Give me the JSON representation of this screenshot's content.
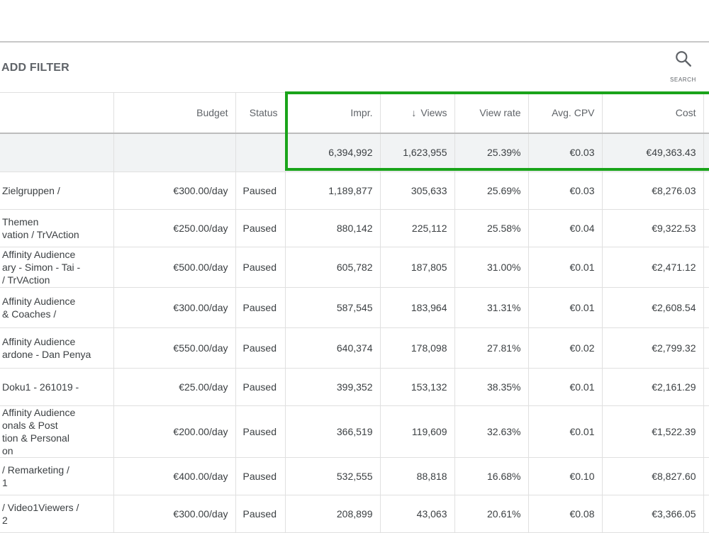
{
  "toolbar": {
    "add_filter_label": "ADD FILTER",
    "search_label": "SEARCH",
    "search_icon": "search-icon"
  },
  "table": {
    "headers": {
      "budget": "Budget",
      "status": "Status",
      "impr": "Impr.",
      "views": "Views",
      "view_rate": "View rate",
      "avg_cpv": "Avg. CPV",
      "cost": "Cost"
    },
    "totals": {
      "impr": "6,394,992",
      "views": "1,623,955",
      "view_rate": "25.39%",
      "avg_cpv": "€0.03",
      "cost": "€49,363.43"
    },
    "rows": [
      {
        "campaign": [
          "Zielgruppen /"
        ],
        "budget": "€300.00/day",
        "status": "Paused",
        "impr": "1,189,877",
        "views": "305,633",
        "view_rate": "25.69%",
        "avg_cpv": "€0.03",
        "cost": "€8,276.03"
      },
      {
        "campaign": [
          "Themen",
          "vation / TrVAction"
        ],
        "budget": "€250.00/day",
        "status": "Paused",
        "impr": "880,142",
        "views": "225,112",
        "view_rate": "25.58%",
        "avg_cpv": "€0.04",
        "cost": "€9,322.53"
      },
      {
        "campaign": [
          "Affinity Audience",
          "ary - Simon - Tai -",
          "/ TrVAction"
        ],
        "budget": "€500.00/day",
        "status": "Paused",
        "impr": "605,782",
        "views": "187,805",
        "view_rate": "31.00%",
        "avg_cpv": "€0.01",
        "cost": "€2,471.12"
      },
      {
        "campaign": [
          "Affinity Audience",
          "& Coaches /"
        ],
        "budget": "€300.00/day",
        "status": "Paused",
        "impr": "587,545",
        "views": "183,964",
        "view_rate": "31.31%",
        "avg_cpv": "€0.01",
        "cost": "€2,608.54"
      },
      {
        "campaign": [
          "Affinity Audience",
          "ardone - Dan Penya"
        ],
        "budget": "€550.00/day",
        "status": "Paused",
        "impr": "640,374",
        "views": "178,098",
        "view_rate": "27.81%",
        "avg_cpv": "€0.02",
        "cost": "€2,799.32"
      },
      {
        "campaign": [
          "Doku1 - 261019 -"
        ],
        "budget": "€25.00/day",
        "status": "Paused",
        "impr": "399,352",
        "views": "153,132",
        "view_rate": "38.35%",
        "avg_cpv": "€0.01",
        "cost": "€2,161.29"
      },
      {
        "campaign": [
          "Affinity Audience",
          "onals & Post",
          "tion & Personal",
          "on"
        ],
        "budget": "€200.00/day",
        "status": "Paused",
        "impr": "366,519",
        "views": "119,609",
        "view_rate": "32.63%",
        "avg_cpv": "€0.01",
        "cost": "€1,522.39"
      },
      {
        "campaign": [
          "/ Remarketing /",
          "1"
        ],
        "budget": "€400.00/day",
        "status": "Paused",
        "impr": "532,555",
        "views": "88,818",
        "view_rate": "16.68%",
        "avg_cpv": "€0.10",
        "cost": "€8,827.60"
      },
      {
        "campaign": [
          "/ Video1Viewers /",
          "2"
        ],
        "budget": "€300.00/day",
        "status": "Paused",
        "impr": "208,899",
        "views": "43,063",
        "view_rate": "20.61%",
        "avg_cpv": "€0.08",
        "cost": "€3,366.05"
      }
    ]
  },
  "colors": {
    "highlight": "#1aa41a",
    "link": "#1a73e8"
  }
}
